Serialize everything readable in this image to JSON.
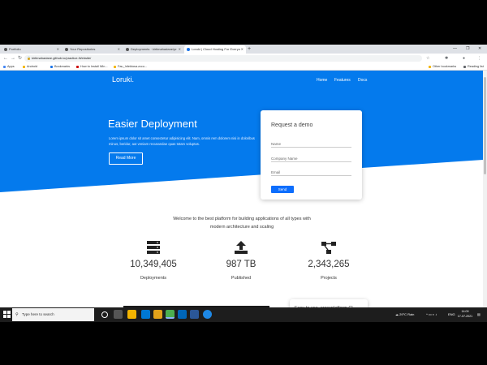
{
  "browser": {
    "tabs": [
      {
        "title": "Portfolio",
        "active": false
      },
      {
        "title": "Your Repositories",
        "active": false
      },
      {
        "title": "Deployments · kirtimahadane/pr",
        "active": false
      },
      {
        "title": "Loruki | Cloud Hosting For Everyo",
        "active": true
      }
    ],
    "new_tab": "+",
    "url": "kirtimahadane.github.io/practice-Website/",
    "bookmarks": [
      "Apps",
      "Android",
      "Bookmarks",
      "How to Install Win...",
      "Fau_Infektosa.zcco..."
    ],
    "other_bookmarks": "Other bookmarks",
    "reading_list": "Reading list"
  },
  "site": {
    "logo": "Loruki.",
    "nav": [
      "Home",
      "Features",
      "Docs"
    ],
    "hero": {
      "title": "Easier Deployment",
      "text": "Lorem ipsum dolor sit amet consectetur adipisicing elit. Nam, omnis rem dolorem nisi in doloribus minus, beridur, aut veniam recusandae quas totam voluptas.",
      "button": "Read More"
    },
    "form": {
      "title": "Request a demo",
      "name_placeholder": "Name",
      "company_placeholder": "Company Name",
      "email_placeholder": "Email",
      "send": "Send"
    },
    "welcome": "Welcome to the best platform for building applications of all types with modern architecture and scaling",
    "stats": [
      {
        "value": "10,349,405",
        "label": "Deployments",
        "icon": "server-icon"
      },
      {
        "value": "987 TB",
        "label": "Published",
        "icon": "upload-icon"
      },
      {
        "value": "2,343,265",
        "label": "Projects",
        "icon": "project-diagram-icon"
      }
    ],
    "feature_peek": "Easy to use, crossplatform CL",
    "status_url": "https://kirtimahadane.github.io/practice-Website/features.html"
  },
  "taskbar": {
    "search_placeholder": "Type here to search",
    "weather": "29°C  Rain",
    "language": "ENG",
    "time": "14:09",
    "date": "17-07-2021"
  },
  "colors": {
    "hero_blue": "#047aed",
    "button_blue": "#0d6efd"
  }
}
